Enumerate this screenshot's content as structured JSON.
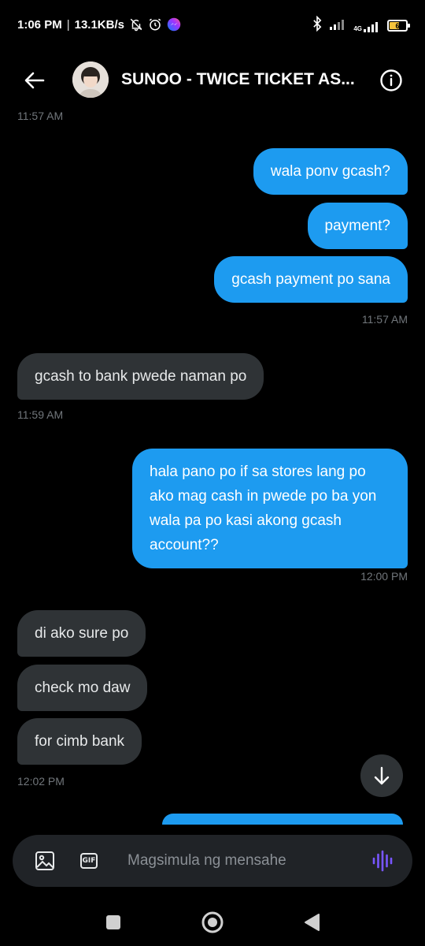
{
  "status_bar": {
    "time": "1:06 PM",
    "separator": "|",
    "net_speed": "13.1KB/s",
    "network": "4G",
    "battery_level": 0.6,
    "battery_text": "6",
    "icons": [
      "bell-off-icon",
      "alarm-icon",
      "messenger-icon",
      "bluetooth-icon",
      "signal-icon",
      "signal-4g-icon",
      "battery-icon"
    ]
  },
  "header": {
    "title": "SUNOO - TWICE TICKET AS...",
    "back_icon": "arrow-left-icon",
    "info_icon": "info-icon"
  },
  "messages": {
    "ts_top": "11:57 AM",
    "out_1": "wala ponv gcash?",
    "out_2": "payment?",
    "out_3": "gcash payment po sana",
    "ts_out_1": "11:57 AM",
    "in_1": "gcash to bank pwede naman po",
    "ts_in_1": "11:59 AM",
    "out_4": "hala pano po if sa stores lang po ako mag cash in pwede po ba yon wala pa po kasi akong gcash account??",
    "ts_out_2": "12:00 PM",
    "in_2": "di ako sure po",
    "in_3": "check mo daw",
    "in_4": "for cimb bank",
    "ts_in_2": "12:02 PM"
  },
  "composer": {
    "placeholder": "Magsimula ng mensahe",
    "gif_label": "GIF"
  },
  "colors": {
    "background": "#000000",
    "outgoing_bubble": "#1d9bf0",
    "incoming_bubble": "#2f3336",
    "timestamp": "#71767b",
    "voice_accent": "#7856ff",
    "battery_fill": "#f5c33b"
  }
}
